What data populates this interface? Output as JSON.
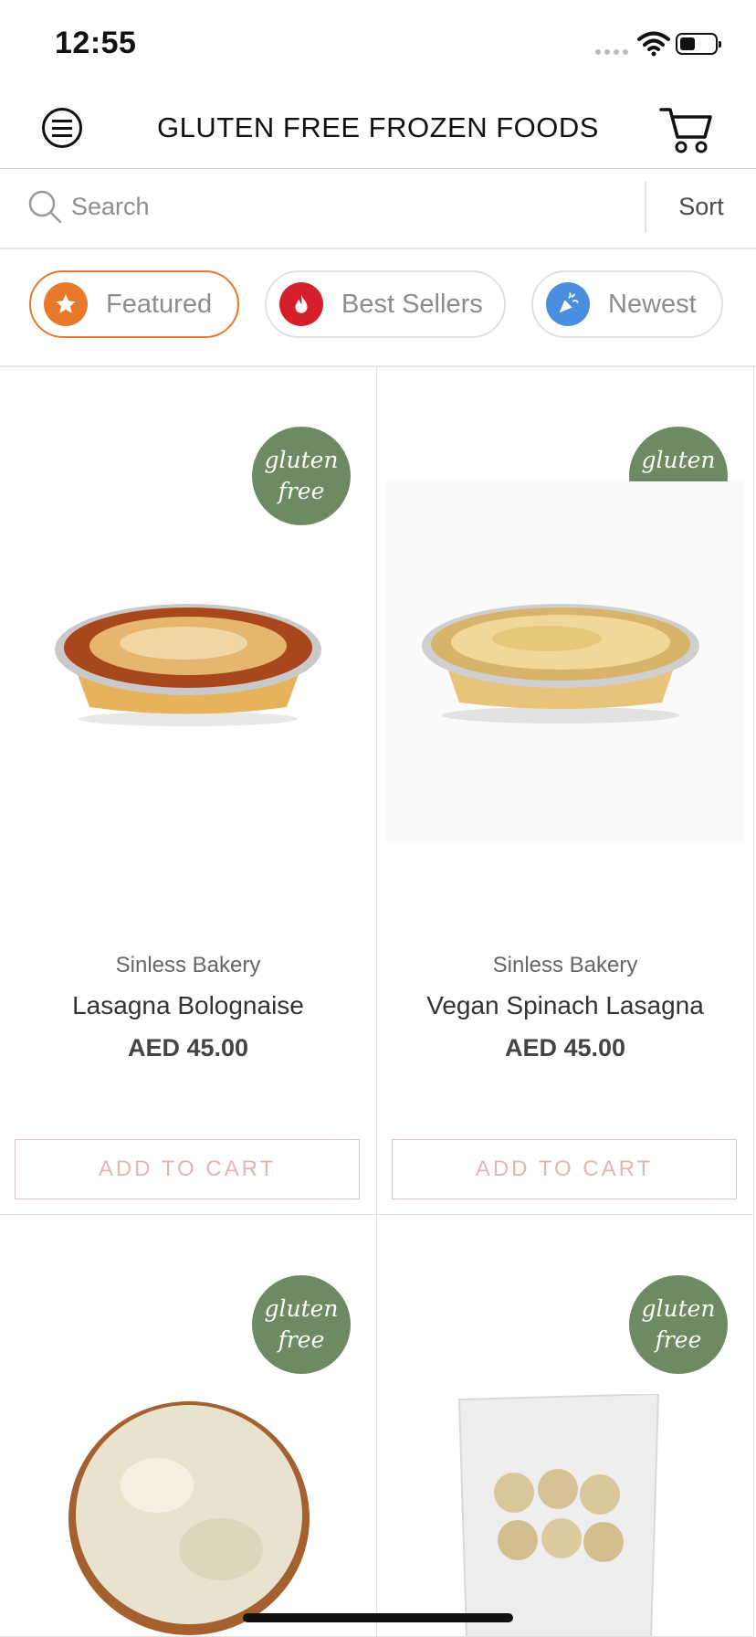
{
  "status": {
    "time": "12:55"
  },
  "header": {
    "title": "GLUTEN FREE FROZEN FOODS",
    "menu_icon": "menu-icon",
    "cart_icon": "cart-icon"
  },
  "search": {
    "placeholder": "Search",
    "sort_label": "Sort"
  },
  "filters": [
    {
      "label": "Featured",
      "icon": "star-icon",
      "color": "#e8782a",
      "active": true
    },
    {
      "label": "Best Sellers",
      "icon": "flame-icon",
      "color": "#d51f2b",
      "active": false
    },
    {
      "label": "Newest",
      "icon": "party-icon",
      "color": "#4a8ee0",
      "active": false
    }
  ],
  "badge": {
    "line1": "gluten",
    "line2": "free",
    "color": "#6e8a62"
  },
  "products": [
    {
      "brand": "Sinless Bakery",
      "name": "Lasagna Bolognaise",
      "price": "AED 45.00",
      "button": "ADD TO CART"
    },
    {
      "brand": "Sinless Bakery",
      "name": "Vegan Spinach Lasagna",
      "price": "AED 45.00",
      "button": "ADD TO CART"
    },
    {
      "brand": "",
      "name": "",
      "price": "",
      "button": ""
    },
    {
      "brand": "",
      "name": "",
      "price": "",
      "button": ""
    }
  ]
}
